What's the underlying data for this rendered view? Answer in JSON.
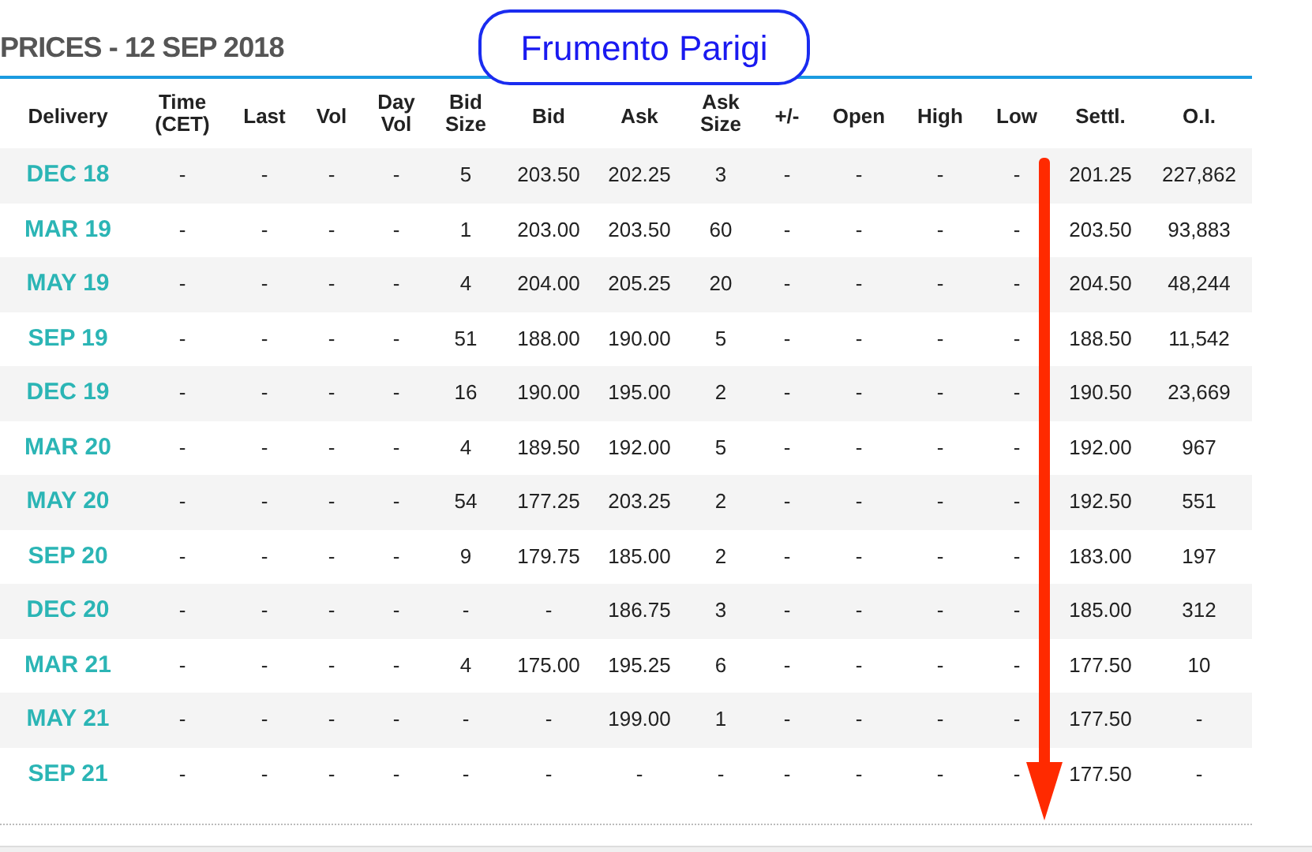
{
  "heading": "PRICES - 12 SEP 2018",
  "callout": {
    "text": "Frumento Parigi"
  },
  "table": {
    "columns": [
      "Delivery",
      "Time (CET)",
      "Last",
      "Vol",
      "Day Vol",
      "Bid Size",
      "Bid",
      "Ask",
      "Ask Size",
      "+/-",
      "Open",
      "High",
      "Low",
      "Settl.",
      "O.I."
    ],
    "rows": [
      [
        "DEC 18",
        "-",
        "-",
        "-",
        "-",
        "5",
        "203.50",
        "202.25",
        "3",
        "-",
        "-",
        "-",
        "-",
        "201.25",
        "227,862"
      ],
      [
        "MAR 19",
        "-",
        "-",
        "-",
        "-",
        "1",
        "203.00",
        "203.50",
        "60",
        "-",
        "-",
        "-",
        "-",
        "203.50",
        "93,883"
      ],
      [
        "MAY 19",
        "-",
        "-",
        "-",
        "-",
        "4",
        "204.00",
        "205.25",
        "20",
        "-",
        "-",
        "-",
        "-",
        "204.50",
        "48,244"
      ],
      [
        "SEP 19",
        "-",
        "-",
        "-",
        "-",
        "51",
        "188.00",
        "190.00",
        "5",
        "-",
        "-",
        "-",
        "-",
        "188.50",
        "11,542"
      ],
      [
        "DEC 19",
        "-",
        "-",
        "-",
        "-",
        "16",
        "190.00",
        "195.00",
        "2",
        "-",
        "-",
        "-",
        "-",
        "190.50",
        "23,669"
      ],
      [
        "MAR 20",
        "-",
        "-",
        "-",
        "-",
        "4",
        "189.50",
        "192.00",
        "5",
        "-",
        "-",
        "-",
        "-",
        "192.00",
        "967"
      ],
      [
        "MAY 20",
        "-",
        "-",
        "-",
        "-",
        "54",
        "177.25",
        "203.25",
        "2",
        "-",
        "-",
        "-",
        "-",
        "192.50",
        "551"
      ],
      [
        "SEP 20",
        "-",
        "-",
        "-",
        "-",
        "9",
        "179.75",
        "185.00",
        "2",
        "-",
        "-",
        "-",
        "-",
        "183.00",
        "197"
      ],
      [
        "DEC 20",
        "-",
        "-",
        "-",
        "-",
        "-",
        "-",
        "186.75",
        "3",
        "-",
        "-",
        "-",
        "-",
        "185.00",
        "312"
      ],
      [
        "MAR 21",
        "-",
        "-",
        "-",
        "-",
        "4",
        "175.00",
        "195.25",
        "6",
        "-",
        "-",
        "-",
        "-",
        "177.50",
        "10"
      ],
      [
        "MAY 21",
        "-",
        "-",
        "-",
        "-",
        "-",
        "-",
        "199.00",
        "1",
        "-",
        "-",
        "-",
        "-",
        "177.50",
        "-"
      ],
      [
        "SEP 21",
        "-",
        "-",
        "-",
        "-",
        "-",
        "-",
        "-",
        "-",
        "-",
        "-",
        "-",
        "-",
        "177.50",
        "-"
      ]
    ]
  }
}
